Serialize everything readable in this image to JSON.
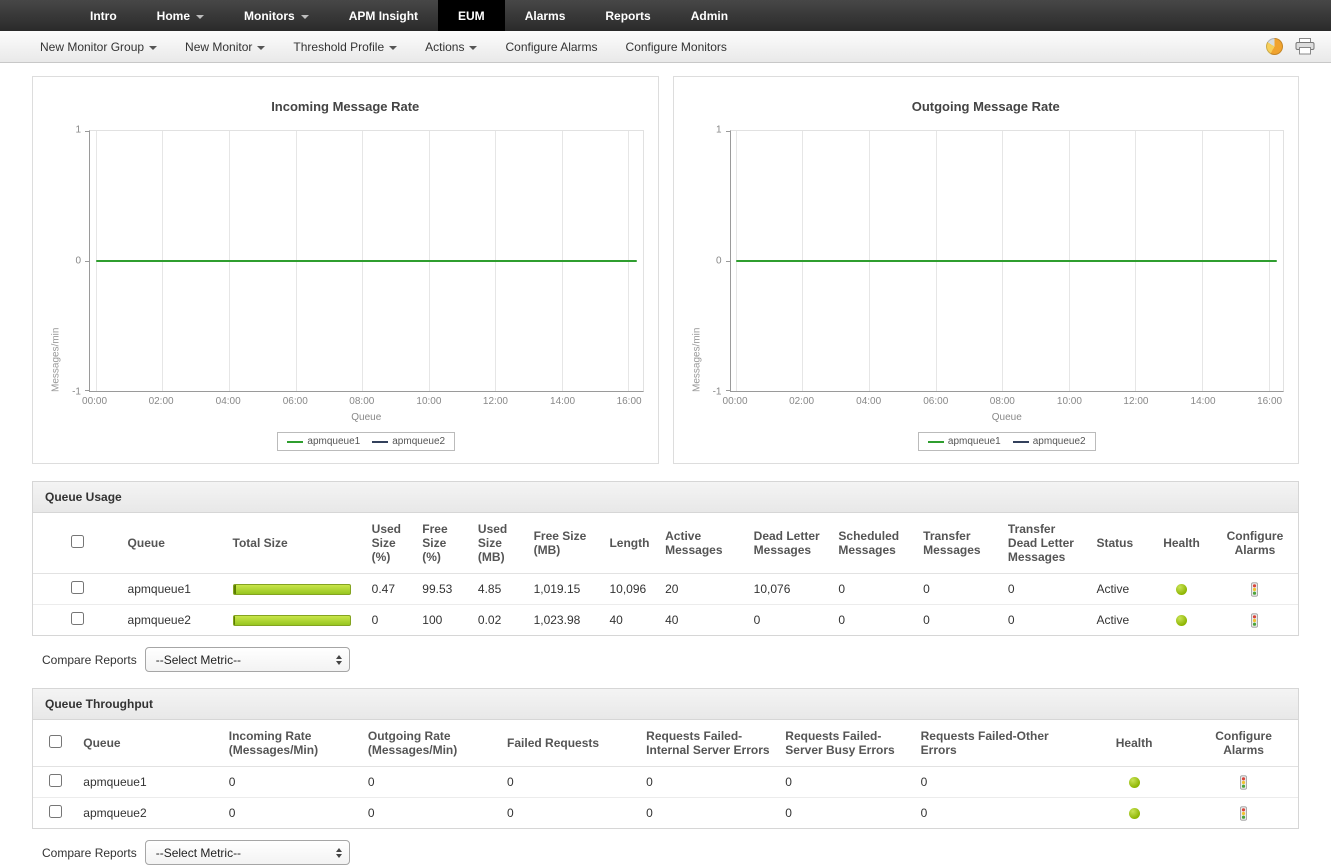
{
  "topnav": {
    "items": [
      {
        "label": "Intro"
      },
      {
        "label": "Home",
        "has_caret": true
      },
      {
        "label": "Monitors",
        "has_caret": true
      },
      {
        "label": "APM Insight"
      },
      {
        "label": "EUM",
        "active": true
      },
      {
        "label": "Alarms"
      },
      {
        "label": "Reports"
      },
      {
        "label": "Admin"
      }
    ]
  },
  "toolbar": {
    "new_monitor_group": "New Monitor Group",
    "new_monitor": "New Monitor",
    "threshold_profile": "Threshold Profile",
    "actions": "Actions",
    "configure_alarms": "Configure Alarms",
    "configure_monitors": "Configure Monitors",
    "icons": [
      "theme-icon",
      "print-icon"
    ]
  },
  "chart_data": [
    {
      "type": "line",
      "title": "Incoming Message Rate",
      "ylabel": "Messages/min",
      "xlabel": "Queue",
      "ylim": [
        -1,
        1
      ],
      "y_ticks": [
        "1",
        "0",
        "-1"
      ],
      "x_ticks": [
        "00:00",
        "02:00",
        "04:00",
        "06:00",
        "08:00",
        "10:00",
        "12:00",
        "14:00",
        "16:00"
      ],
      "grid": true,
      "legend_position": "bottom",
      "series": [
        {
          "name": "apmqueue1",
          "color": "#2f9e2f",
          "values": [
            0,
            0,
            0,
            0,
            0,
            0,
            0,
            0,
            0
          ]
        },
        {
          "name": "apmqueue2",
          "color": "#33415c",
          "values": [
            0,
            0,
            0,
            0,
            0,
            0,
            0,
            0,
            0
          ]
        }
      ]
    },
    {
      "type": "line",
      "title": "Outgoing Message Rate",
      "ylabel": "Messages/min",
      "xlabel": "Queue",
      "ylim": [
        -1,
        1
      ],
      "y_ticks": [
        "1",
        "0",
        "-1"
      ],
      "x_ticks": [
        "00:00",
        "02:00",
        "04:00",
        "06:00",
        "08:00",
        "10:00",
        "12:00",
        "14:00",
        "16:00"
      ],
      "grid": true,
      "legend_position": "bottom",
      "series": [
        {
          "name": "apmqueue1",
          "color": "#2f9e2f",
          "values": [
            0,
            0,
            0,
            0,
            0,
            0,
            0,
            0,
            0
          ]
        },
        {
          "name": "apmqueue2",
          "color": "#33415c",
          "values": [
            0,
            0,
            0,
            0,
            0,
            0,
            0,
            0,
            0
          ]
        }
      ]
    }
  ],
  "queue_usage": {
    "title": "Queue Usage",
    "headers": [
      "Queue",
      "Total Size",
      "Used Size (%)",
      "Free Size (%)",
      "Used Size (MB)",
      "Free Size (MB)",
      "Length",
      "Active Messages",
      "Dead Letter Messages",
      "Scheduled Messages",
      "Transfer Messages",
      "Transfer Dead Letter Messages",
      "Status",
      "Health",
      "Configure Alarms"
    ],
    "rows": [
      {
        "queue": "apmqueue1",
        "used_size_pct": "0.47",
        "free_size_pct": "99.53",
        "used_size_mb": "4.85",
        "free_size_mb": "1,019.15",
        "length": "10,096",
        "active_messages": "20",
        "dead_letter_messages": "10,076",
        "scheduled_messages": "0",
        "transfer_messages": "0",
        "transfer_dead_letter_messages": "0",
        "status": "Active",
        "health": "green"
      },
      {
        "queue": "apmqueue2",
        "used_size_pct": "0",
        "free_size_pct": "100",
        "used_size_mb": "0.02",
        "free_size_mb": "1,023.98",
        "length": "40",
        "active_messages": "40",
        "dead_letter_messages": "0",
        "scheduled_messages": "0",
        "transfer_messages": "0",
        "transfer_dead_letter_messages": "0",
        "status": "Active",
        "health": "green"
      }
    ],
    "compare_reports_label": "Compare Reports",
    "select_metric": "--Select Metric--"
  },
  "queue_throughput": {
    "title": "Queue Throughput",
    "headers": [
      "Queue",
      "Incoming Rate (Messages/Min)",
      "Outgoing Rate (Messages/Min)",
      "Failed Requests",
      "Requests Failed-Internal Server Errors",
      "Requests Failed-Server Busy Errors",
      "Requests Failed-Other Errors",
      "Health",
      "Configure Alarms"
    ],
    "rows": [
      {
        "queue": "apmqueue1",
        "incoming_rate": "0",
        "outgoing_rate": "0",
        "failed_requests": "0",
        "requests_failed_internal_server_errors": "0",
        "requests_failed_server_busy_errors": "0",
        "requests_failed_other_errors": "0",
        "health": "green"
      },
      {
        "queue": "apmqueue2",
        "incoming_rate": "0",
        "outgoing_rate": "0",
        "failed_requests": "0",
        "requests_failed_internal_server_errors": "0",
        "requests_failed_server_busy_errors": "0",
        "requests_failed_other_errors": "0",
        "health": "green"
      }
    ],
    "compare_reports_label": "Compare Reports",
    "select_metric": "--Select Metric--"
  },
  "colors": {
    "nav_bg": "#333333",
    "nav_active_bg": "#000000",
    "series_green": "#2f9e2f",
    "series_navy": "#33415c",
    "bar_green": "#9ccb27",
    "health_green": "#8cb400"
  }
}
